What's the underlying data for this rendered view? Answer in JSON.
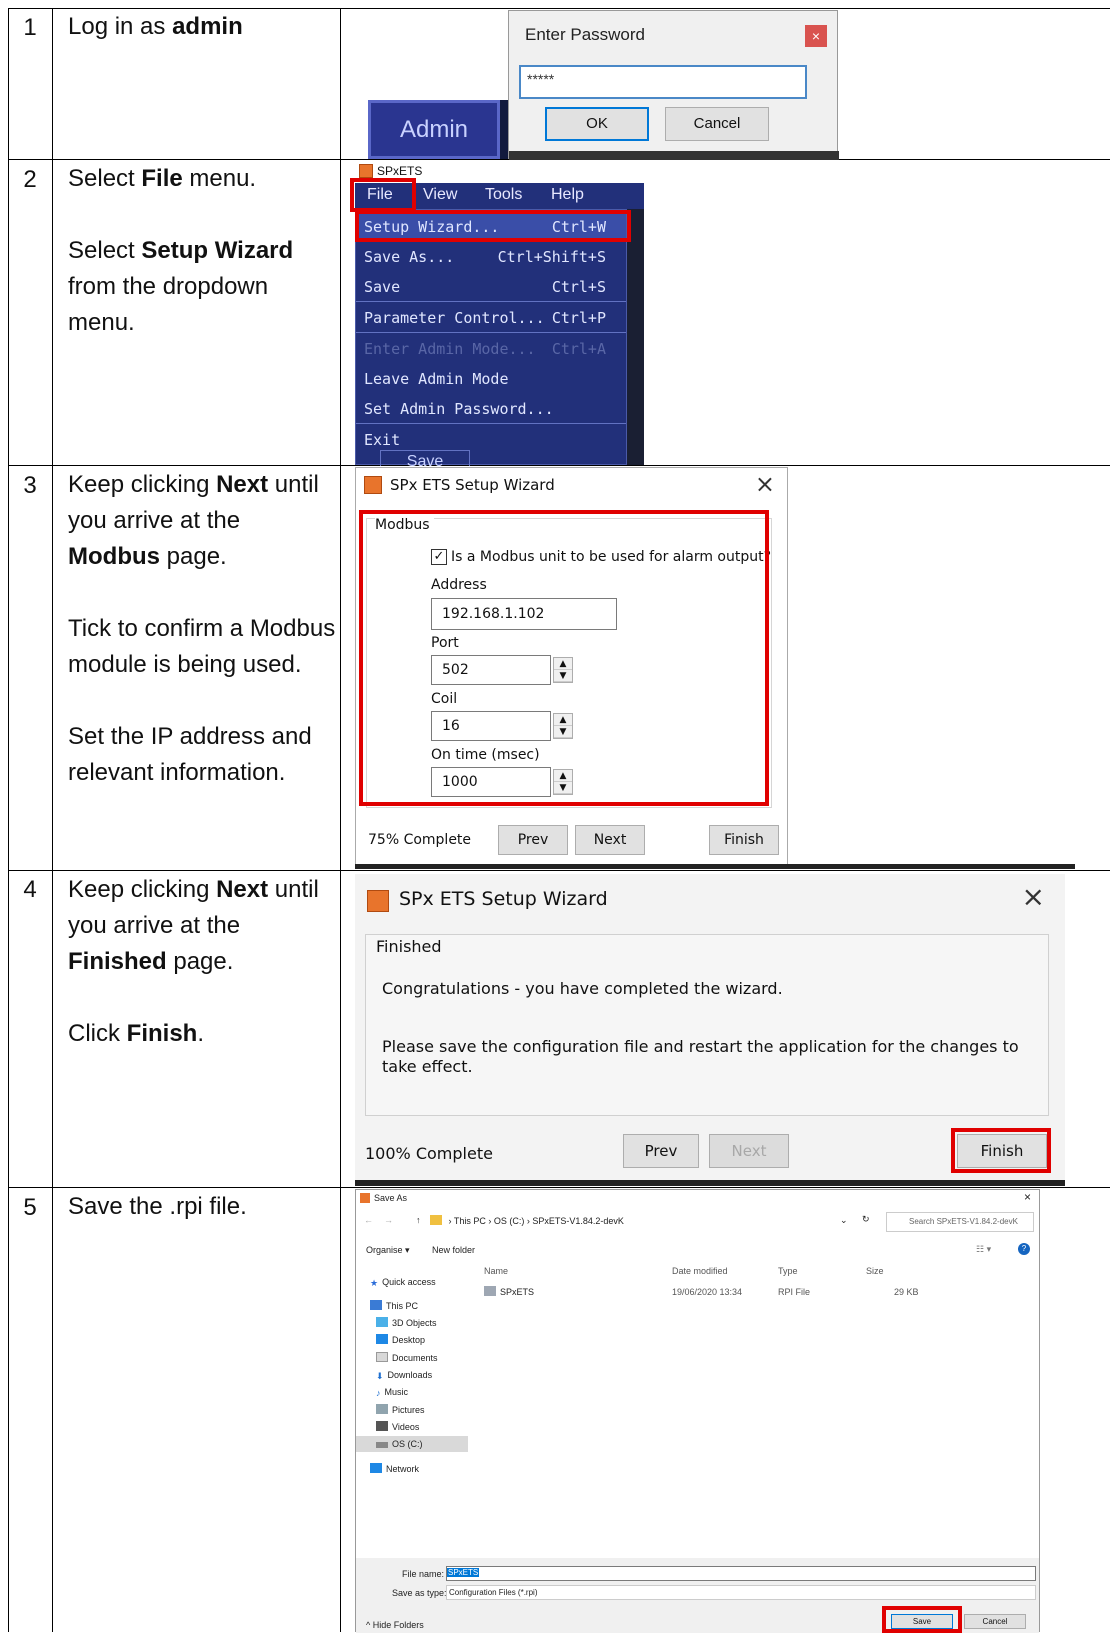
{
  "steps": [
    {
      "num": "1"
    },
    {
      "num": "2"
    },
    {
      "num": "3"
    },
    {
      "num": "4"
    },
    {
      "num": "5"
    }
  ],
  "step1": {
    "text_pre": "Log in as ",
    "text_bold": "admin",
    "admin_button": "Admin",
    "dialog_title": "Enter Password",
    "password_value": "*****",
    "ok": "OK",
    "cancel": "Cancel",
    "close": "×"
  },
  "step2": {
    "p1_pre": "Select ",
    "p1_bold": "File",
    "p1_post": " menu.",
    "p2_pre": "Select ",
    "p2_bold": "Setup Wizard",
    "p2_post": " from the dropdown menu.",
    "app_title": "SPxETS",
    "menubar": [
      "File",
      "View",
      "Tools",
      "Help"
    ],
    "items": [
      {
        "label": "Setup Wizard...",
        "shortcut": "Ctrl+W"
      },
      {
        "label": "Save As...",
        "shortcut": "Ctrl+Shift+S"
      },
      {
        "label": "Save",
        "shortcut": "Ctrl+S"
      },
      {
        "label": "Parameter Control...",
        "shortcut": "Ctrl+P"
      },
      {
        "label": "Enter Admin Mode...",
        "shortcut": "Ctrl+A"
      },
      {
        "label": "Leave Admin Mode",
        "shortcut": ""
      },
      {
        "label": "Set Admin Password...",
        "shortcut": ""
      },
      {
        "label": "Exit",
        "shortcut": ""
      }
    ],
    "partial_button": "Save"
  },
  "step3": {
    "p1_a": "Keep clicking ",
    "p1_b": "Next",
    "p1_c": " until you arrive at the ",
    "p1_d": "Modbus",
    "p1_e": " page.",
    "p2": "Tick to confirm a Modbus module is being used.",
    "p3": "Set the IP address and relevant information.",
    "title": "SPx ETS Setup Wizard",
    "group": "Modbus",
    "checkbox_label": "Is a Modbus unit to be used for alarm output?",
    "address_label": "Address",
    "address_value": "192.168.1.102",
    "port_label": "Port",
    "port_value": "502",
    "coil_label": "Coil",
    "coil_value": "16",
    "ontime_label": "On time (msec)",
    "ontime_value": "1000",
    "progress": "75% Complete",
    "prev": "Prev",
    "next": "Next",
    "finish": "Finish"
  },
  "step4": {
    "p1_a": "Keep clicking ",
    "p1_b": "Next",
    "p1_c": " until you arrive at the ",
    "p1_d": "Finished",
    "p1_e": " page.",
    "p2_a": "Click ",
    "p2_b": "Finish",
    "p2_c": ".",
    "title": "SPx ETS Setup Wizard",
    "group": "Finished",
    "congrats": "Congratulations - you have completed the wizard.",
    "instruction": "Please save the configuration file and restart the application for the changes to take effect.",
    "progress": "100% Complete",
    "prev": "Prev",
    "next": "Next",
    "finish": "Finish"
  },
  "step5": {
    "text": "Save the .rpi file.",
    "title": "Save As",
    "breadcrumb": [
      "This PC",
      "OS (C:)",
      "SPxETS-V1.84.2-devK"
    ],
    "search_placeholder": "Search SPxETS-V1.84.2-devK",
    "organise": "Organise ▾",
    "new_folder": "New folder",
    "columns": [
      "Name",
      "Date modified",
      "Type",
      "Size"
    ],
    "file": {
      "name": "SPxETS",
      "date": "19/06/2020 13:34",
      "type": "RPI File",
      "size": "29 KB"
    },
    "nav": [
      "Quick access",
      "This PC",
      "3D Objects",
      "Desktop",
      "Documents",
      "Downloads",
      "Music",
      "Pictures",
      "Videos",
      "OS (C:)",
      "Network"
    ],
    "filename_label": "File name:",
    "filename_value": "SPxETS",
    "savetype_label": "Save as type:",
    "savetype_value": "Configuration Files (*.rpi)",
    "hide_folders": "Hide Folders",
    "save": "Save",
    "cancel": "Cancel"
  },
  "colors": {
    "highlight": "#e00000",
    "menu_bg": "#22307a",
    "admin_bg": "#2a3590"
  }
}
